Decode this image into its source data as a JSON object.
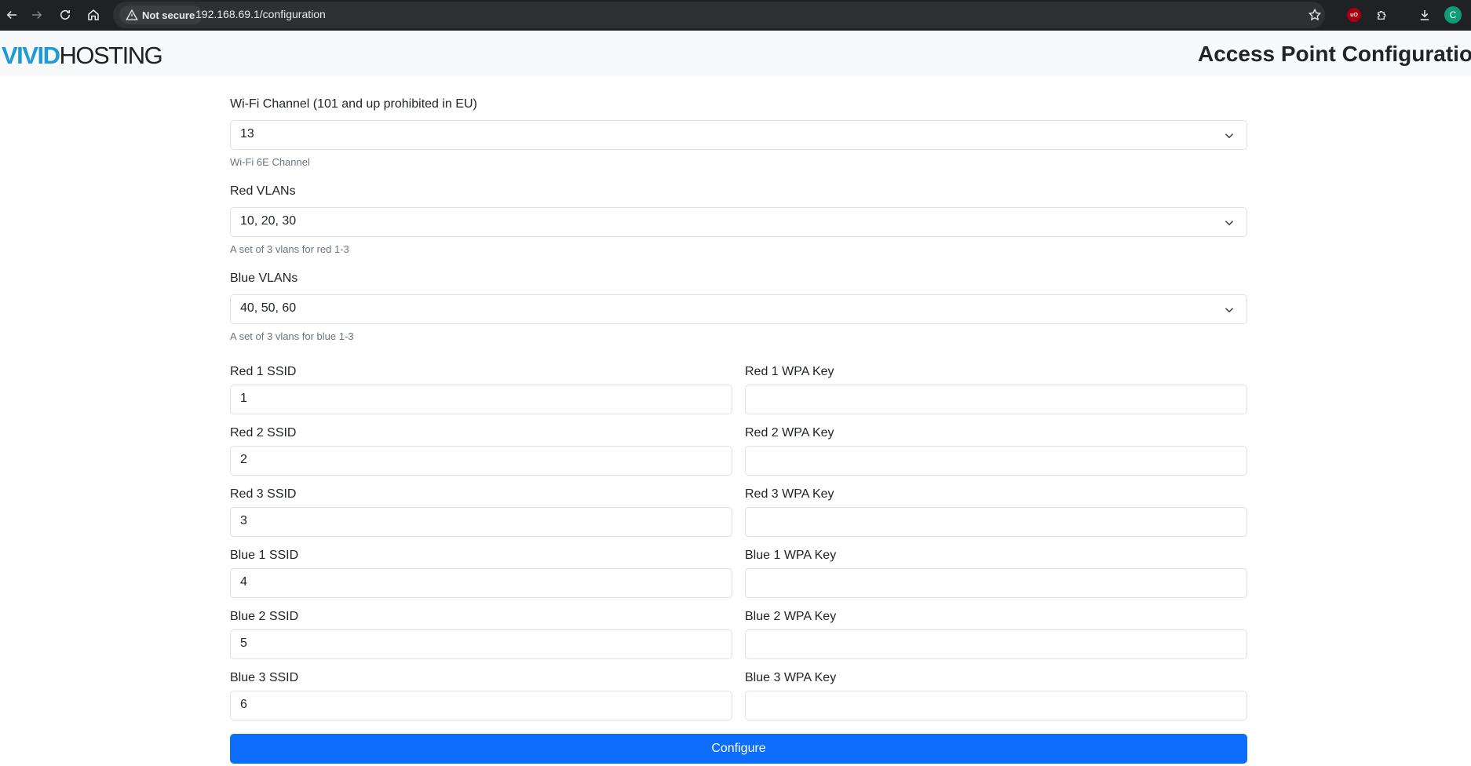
{
  "browser": {
    "security_label": "Not secure",
    "url": "192.168.69.1/configuration",
    "ublock_label": "uO",
    "profile_initial": "C"
  },
  "header": {
    "logo_vivid": "VIVID",
    "logo_hosting": "HOSTING",
    "title": "Access Point Configuration"
  },
  "form": {
    "channel": {
      "label": "Wi-Fi Channel (101 and up prohibited in EU)",
      "value": "13",
      "help": "Wi-Fi 6E Channel"
    },
    "red_vlans": {
      "label": "Red VLANs",
      "value": "10, 20, 30",
      "help": "A set of 3 vlans for red 1-3"
    },
    "blue_vlans": {
      "label": "Blue VLANs",
      "value": "40, 50, 60",
      "help": "A set of 3 vlans for blue 1-3"
    },
    "networks": [
      {
        "ssid_label": "Red 1 SSID",
        "ssid_value": "1",
        "key_label": "Red 1 WPA Key",
        "key_value": ""
      },
      {
        "ssid_label": "Red 2 SSID",
        "ssid_value": "2",
        "key_label": "Red 2 WPA Key",
        "key_value": ""
      },
      {
        "ssid_label": "Red 3 SSID",
        "ssid_value": "3",
        "key_label": "Red 3 WPA Key",
        "key_value": ""
      },
      {
        "ssid_label": "Blue 1 SSID",
        "ssid_value": "4",
        "key_label": "Blue 1 WPA Key",
        "key_value": ""
      },
      {
        "ssid_label": "Blue 2 SSID",
        "ssid_value": "5",
        "key_label": "Blue 2 WPA Key",
        "key_value": ""
      },
      {
        "ssid_label": "Blue 3 SSID",
        "ssid_value": "6",
        "key_label": "Blue 3 WPA Key",
        "key_value": ""
      }
    ],
    "submit_label": "Configure"
  },
  "colors": {
    "brand_blue": "#1f9ad6",
    "primary_button": "#0d6efd",
    "browser_bar": "#202124"
  }
}
